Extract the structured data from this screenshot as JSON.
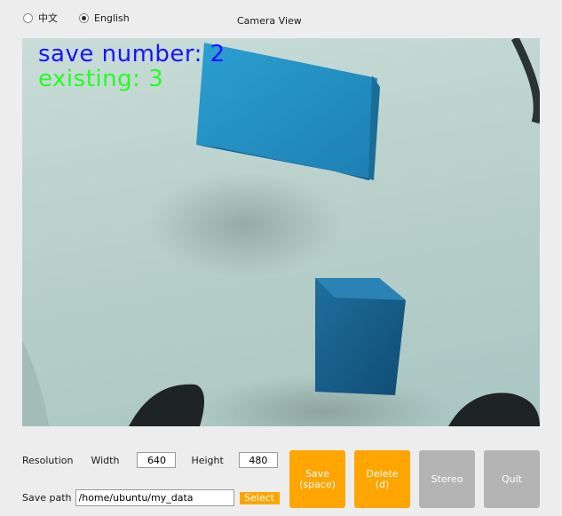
{
  "language": {
    "options": [
      {
        "label": "中文",
        "selected": false
      },
      {
        "label": "English",
        "selected": true
      }
    ]
  },
  "camera": {
    "title": "Camera View",
    "overlay": {
      "save_number": "save number: 2",
      "existing": "existing: 3"
    }
  },
  "resolution": {
    "label": "Resolution",
    "width_label": "Width",
    "width_value": "640",
    "height_label": "Height",
    "height_value": "480"
  },
  "save_path": {
    "label": "Save path",
    "value": "/home/ubuntu/my_data",
    "select_label": "Select"
  },
  "buttons": {
    "save": "Save\n(space)",
    "delete": "Delete\n(d)",
    "stereo": "Stereo",
    "quit": "Quit"
  },
  "colors": {
    "accent": "#ffa500",
    "disabled": "#b4b4b4",
    "overlay_blue": "#1414ff",
    "overlay_green": "#22ff22"
  }
}
